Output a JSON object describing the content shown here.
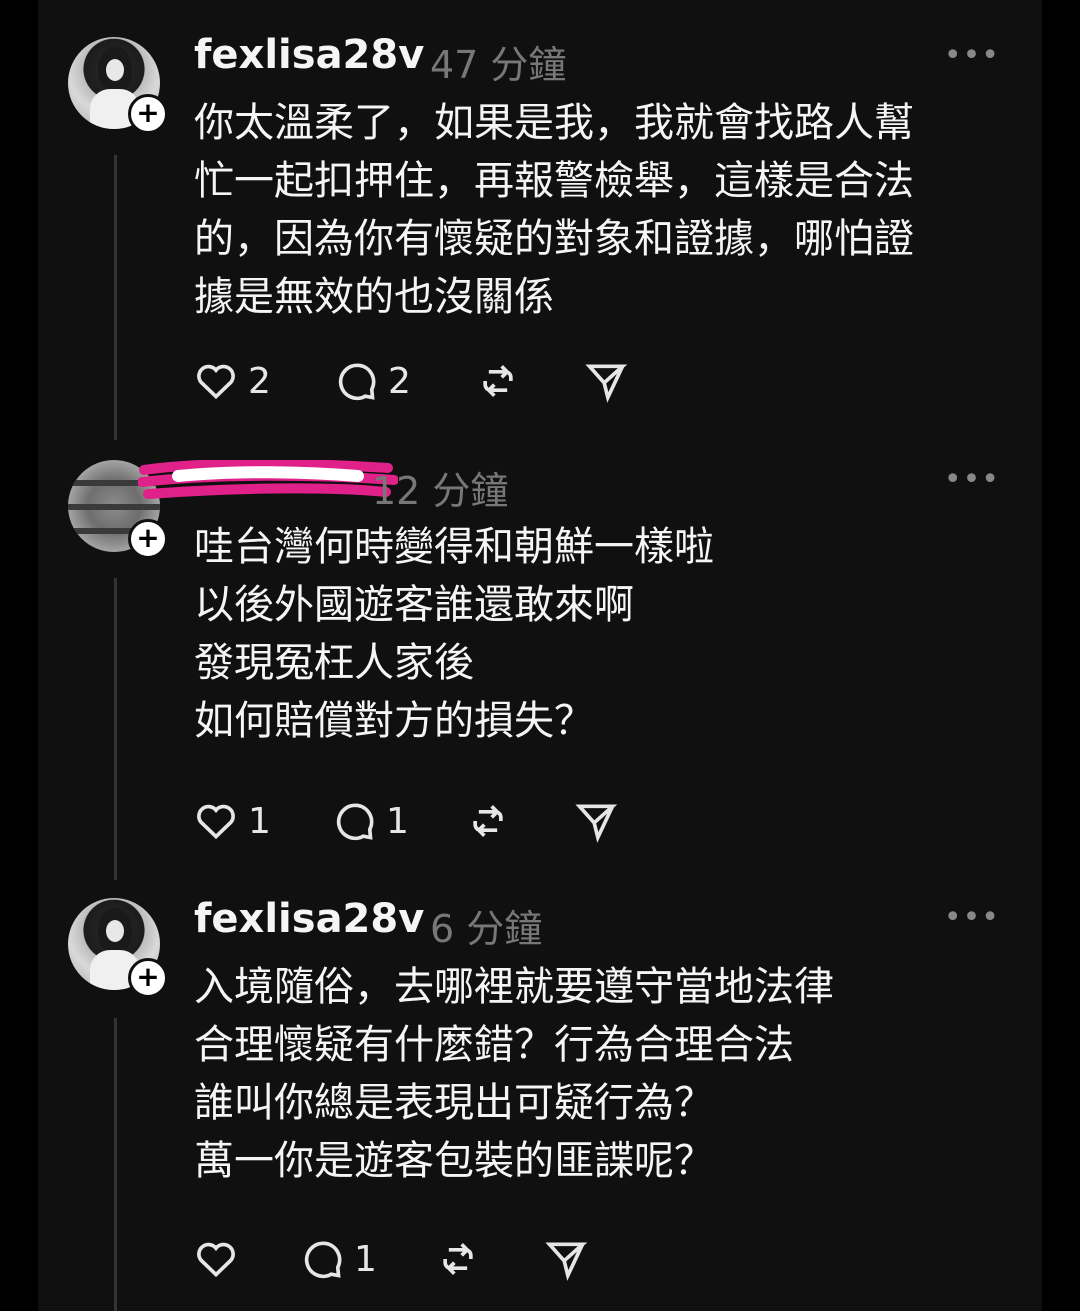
{
  "posts": [
    {
      "username": "fexlisa28v",
      "time": "47 分鐘",
      "text": "你太溫柔了，如果是我，我就會找路人幫\n忙一起扣押住，再報警檢舉，這樣是合法\n的，因為你有懷疑的對象和證據，哪怕證\n據是無效的也沒關係",
      "likes": "2",
      "replies": "2"
    },
    {
      "username": "",
      "time": "12 分鐘",
      "text": "哇台灣何時變得和朝鮮一樣啦\n以後外國遊客誰還敢來啊\n發現冤枉人家後\n如何賠償對方的損失？",
      "likes": "1",
      "replies": "1"
    },
    {
      "username": "fexlisa28v",
      "time": "6 分鐘",
      "text": "入境隨俗，去哪裡就要遵守當地法律\n合理懷疑有什麼錯？行為合理合法\n誰叫你總是表現出可疑行為？\n萬一你是遊客包裝的匪諜呢？",
      "likes": "",
      "replies": "1"
    }
  ],
  "icons": {
    "more": "more-horizontal-icon",
    "like": "heart-icon",
    "reply": "comment-icon",
    "repost": "repost-icon",
    "share": "send-icon",
    "follow": "plus-icon"
  },
  "colors": {
    "background": "#101010",
    "text": "#f3f5f7",
    "muted": "#777777",
    "redaction": "#e0218a"
  }
}
